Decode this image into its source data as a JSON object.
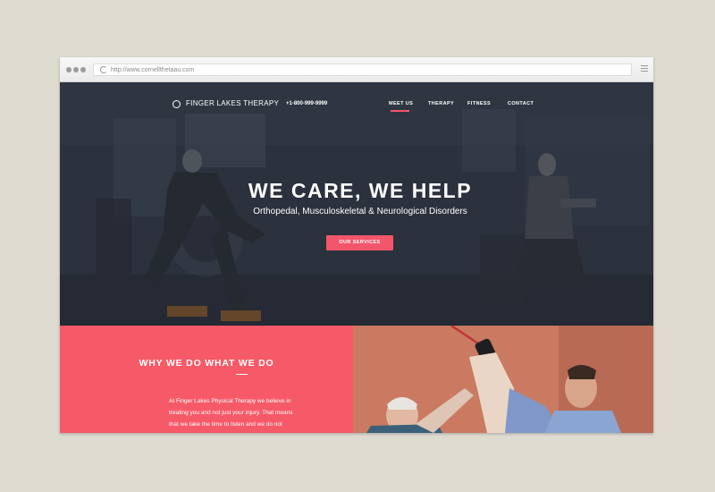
{
  "browser": {
    "url": "http://www.cornellthetaau.com"
  },
  "header": {
    "brand": "FINGER LAKES THERAPY",
    "phone": "+1-800-999-9999",
    "nav": [
      {
        "label": "MEET US",
        "active": true
      },
      {
        "label": "THERAPY",
        "active": false
      },
      {
        "label": "FITNESS",
        "active": false
      },
      {
        "label": "CONTACT",
        "active": false
      }
    ]
  },
  "hero": {
    "title": "WE CARE, WE HELP",
    "subtitle": "Orthopedal, Musculoskeletal & Neurological Disorders",
    "cta_label": "OUR SERVICES"
  },
  "why": {
    "title": "WHY WE DO WHAT WE DO",
    "text_lines": [
      "At Finger Lakes Physical Therapy we believe in",
      "treating you and not just your injury.  That means",
      "that we take the time to listen and we do not"
    ]
  },
  "colors": {
    "accent": "#f65a68",
    "hero_bg": "#2f3440",
    "page_bg": "#dedbd0"
  },
  "icons": [
    "reload-icon",
    "menu-icon",
    "logo-ring-icon"
  ]
}
